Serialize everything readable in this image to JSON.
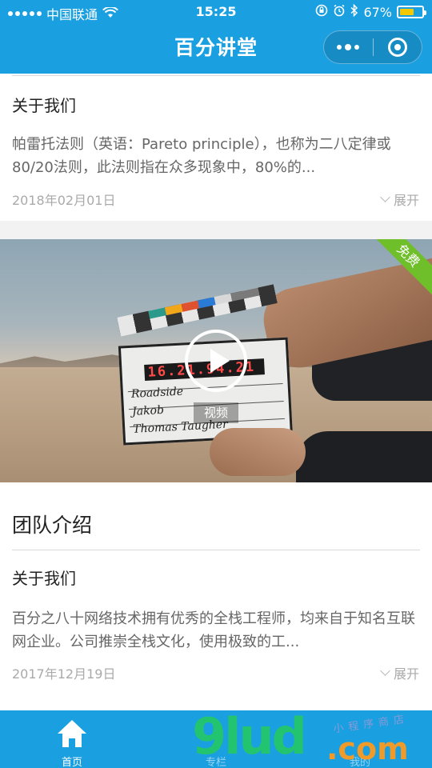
{
  "status_bar": {
    "carrier": "中国联通",
    "time": "15:25",
    "battery": "67%",
    "battery_level": 0.67
  },
  "header": {
    "title": "百分讲堂"
  },
  "colors": {
    "brand": "#1a9fe0",
    "free_ribbon": "#6fbf2a"
  },
  "article_top": {
    "title": "关于我们",
    "desc": "帕雷托法则（英语：Pareto principle），也称为二八定律或80/20法则，此法则指在众多现象中，80%的...",
    "date": "2018年02月01日",
    "expand_label": "展开"
  },
  "video": {
    "badge": "免费",
    "label": "视频",
    "slate_timecode": "16.21.94.21",
    "slate_lines": [
      "Roadside",
      "Jakob",
      "Thomas Taugher"
    ]
  },
  "team_section": {
    "heading": "团队介绍",
    "article": {
      "title": "关于我们",
      "desc": "百分之八十网络技术拥有优秀的全栈工程师，均来自于知名互联网企业。公司推崇全栈文化，使用极致的工...",
      "date": "2017年12月19日",
      "expand_label": "展开"
    }
  },
  "tabbar": {
    "tabs": [
      {
        "label": "首页",
        "icon": "home-icon",
        "active": true
      },
      {
        "label": "专栏",
        "icon": "column-icon",
        "active": false
      },
      {
        "label": "我的",
        "icon": "profile-icon",
        "active": false
      }
    ]
  },
  "watermark": {
    "brand": "9lud",
    "domain": ".com",
    "tagline": "小程序商店"
  }
}
